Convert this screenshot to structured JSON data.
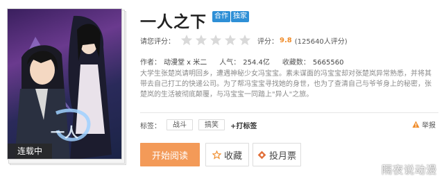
{
  "cover": {
    "status_tag": "连载中"
  },
  "book": {
    "title": "一人之下",
    "badges": [
      "合作",
      "独家"
    ]
  },
  "rating": {
    "prompt": "请您评分：",
    "stars_total": 5,
    "score_label": "评分：",
    "score_value": "9.8",
    "score_count": "(125640人评分)"
  },
  "meta": {
    "author_label": "作者：",
    "author_value": "动漫堂 x 米二",
    "popularity_label": "人气：",
    "popularity_value": "254.4亿",
    "favorites_label": "收藏数：",
    "favorites_value": "5665560"
  },
  "description": "大学生张楚岚请明回乡，遭遇神秘少女冯宝宝。素未谋面的冯宝宝却对张楚岚异常熟悉，并将其带去自己打工的快递公司。为了帮冯宝宝寻找她的身世，也为了查清自己与爷爷身上的秘密，张楚岚的生活被彻底颠覆，与冯宝宝一同踏上\"异人\"之旅。",
  "tags": {
    "label": "标签：",
    "items": [
      "战斗",
      "搞笑"
    ],
    "add_label": "+打标签"
  },
  "report_label": "举报",
  "actions": {
    "read_label": "开始阅读",
    "favorite_label": "收藏",
    "vote_label": "投月票"
  },
  "watermark": "隔夜说动漫",
  "colors": {
    "accent_orange": "#f39a58",
    "score_orange": "#f08c2a",
    "badge_blue": "#2e8fd6"
  }
}
